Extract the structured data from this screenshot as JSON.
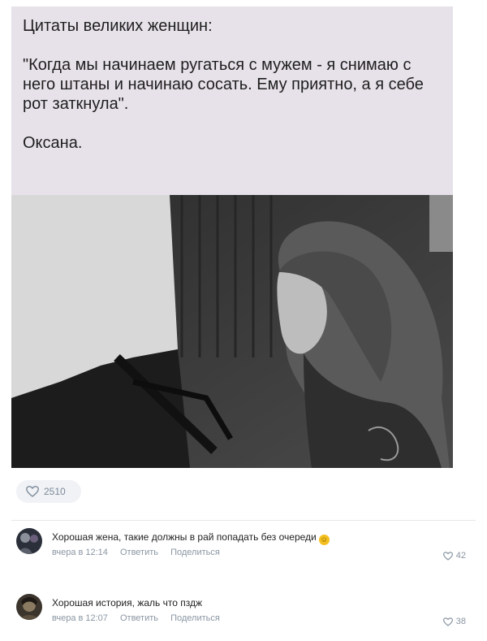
{
  "post": {
    "quote_title": "Цитаты великих женщин:",
    "quote_text": "\"Когда мы начинаем ругаться с мужем - я снимаю с него штаны и начинаю сосать. Ему приятно, а я себе рот заткнула\".",
    "quote_author": "Оксана.",
    "likes": "2510"
  },
  "comments": [
    {
      "text": "Хорошая жена, такие должны в рай попадать без очереди",
      "emoji": "grinning-face-emoji",
      "time": "вчера в 12:14",
      "reply": "Ответить",
      "share": "Поделиться",
      "likes": "42"
    },
    {
      "text": "Хорошая история, жаль что пздж",
      "time": "вчера в 12:07",
      "reply": "Ответить",
      "share": "Поделиться",
      "likes": "38"
    }
  ],
  "colors": {
    "meta": "#8a96a3",
    "quote_bg": "#e7e2ea",
    "emoji": "#f4c020"
  }
}
